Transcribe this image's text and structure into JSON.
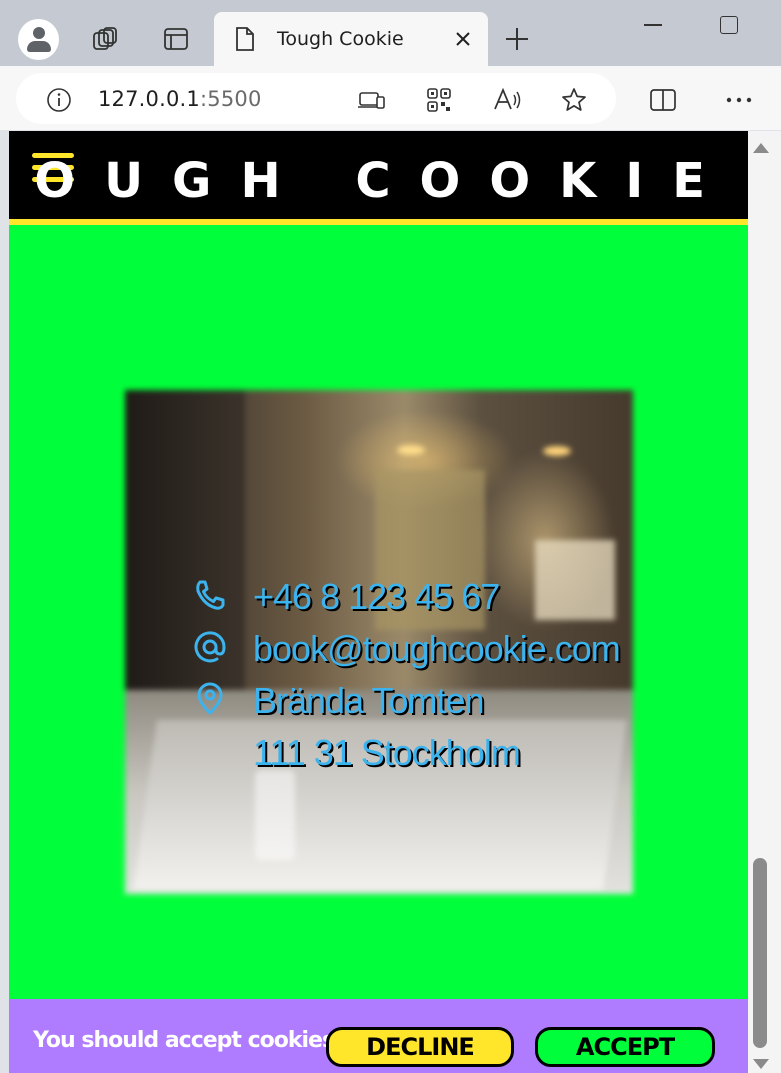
{
  "browser": {
    "tab_title": "Tough Cookie",
    "url_host": "127.0.0.1",
    "url_port": ":5500",
    "icons": [
      "profile-icon",
      "workspaces-icon",
      "tab-actions-icon",
      "page-icon",
      "close-icon",
      "new-tab-icon",
      "minimize-icon",
      "maximize-icon",
      "site-info-icon",
      "app-available-icon",
      "qr-code-icon",
      "read-aloud-icon",
      "favorite-star-icon",
      "split-screen-icon",
      "more-icon"
    ]
  },
  "site": {
    "brand": "TOUGH COOKIE",
    "accent_yellow": "#ffe62b",
    "background_green": "#00ff3a",
    "cookie_bar_purple": "#b07cff"
  },
  "contact": {
    "phone": "+46 8 123 45 67",
    "email": "book@toughcookie.com",
    "address_line1": "Brända Tomten",
    "address_line2": "111 31 Stockholm",
    "text_color": "#3db3ee"
  },
  "cookies": {
    "message": "You should accept cookies.",
    "decline_label": "DECLINE",
    "accept_label": "ACCEPT"
  }
}
